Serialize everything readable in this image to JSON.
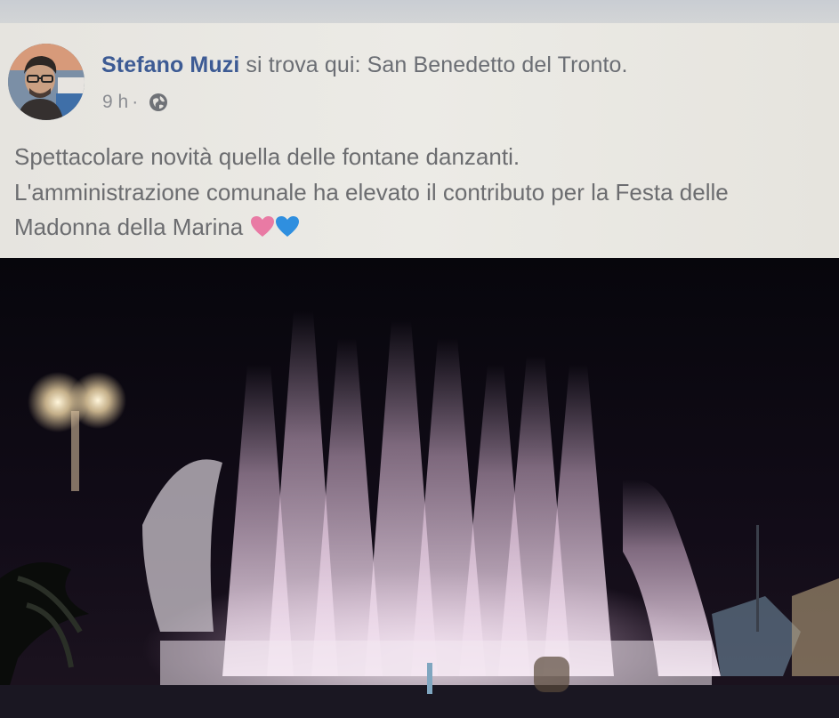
{
  "post": {
    "author_name": "Stefano Muzi",
    "location_prefix": "si trova qui:",
    "location": "San Benedetto del Tronto.",
    "time": "9 h",
    "separator": "·",
    "privacy_icon": "globe-icon",
    "text_lines": [
      "Spettacolare novità quella delle fontane danzanti.",
      "L'amministrazione comunale ha elevato il contributo per la Festa delle",
      "Madonna della Marina"
    ],
    "emoji": [
      {
        "name": "pink-heart-icon",
        "color": "#e97aa4"
      },
      {
        "name": "blue-heart-icon",
        "color": "#2f8fdf"
      }
    ]
  },
  "photo": {
    "subject": "fontane danzanti"
  },
  "colors": {
    "author_link": "#3d5b94",
    "body_text": "#6c6d70",
    "meta_text": "#8b8d92",
    "card_background": "#ebe9e4",
    "photo_background": "#0c0a12"
  }
}
